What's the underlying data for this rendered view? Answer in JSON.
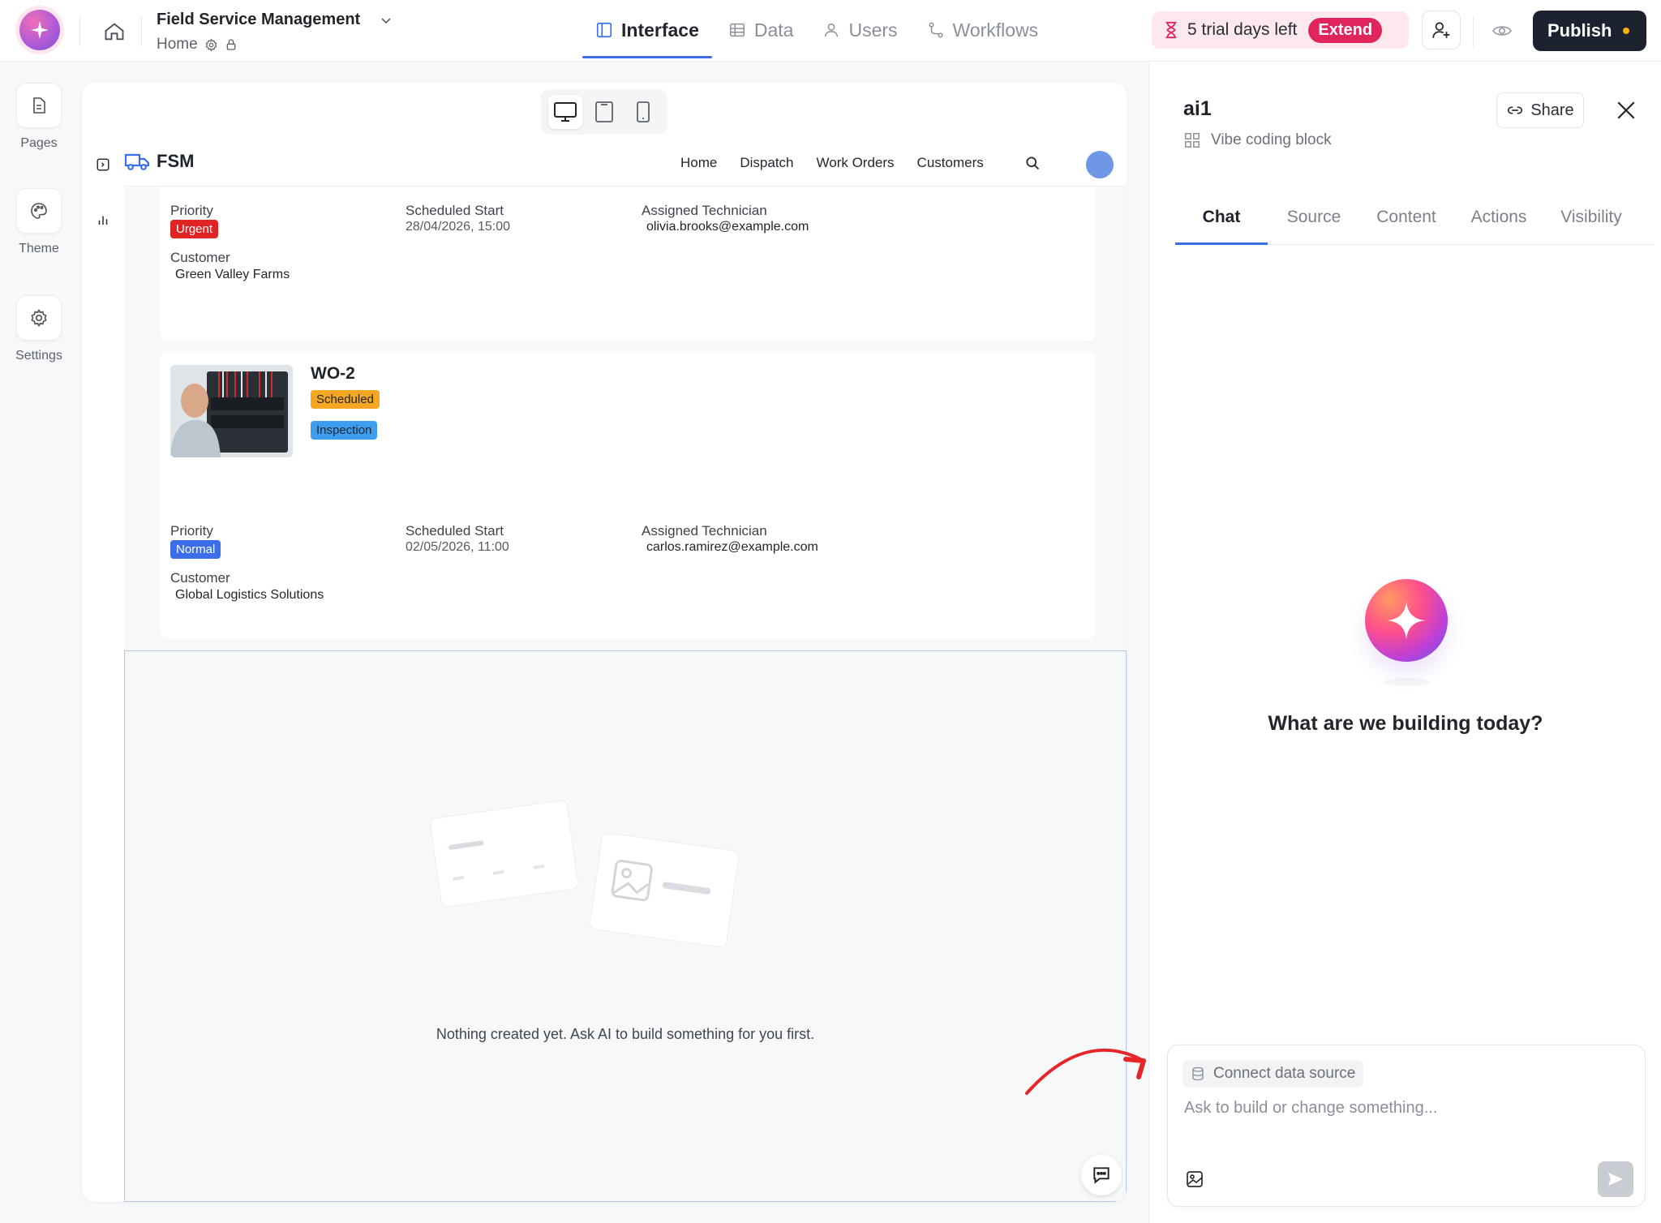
{
  "topbar": {
    "app_title": "Field Service Management",
    "app_subtitle": "Home",
    "tabs": [
      {
        "label": "Interface",
        "active": true
      },
      {
        "label": "Data",
        "active": false
      },
      {
        "label": "Users",
        "active": false
      },
      {
        "label": "Workflows",
        "active": false
      }
    ],
    "trial_text": "5 trial days left",
    "extend_label": "Extend",
    "publish_label": "Publish",
    "accent_color": "#3b6ee8"
  },
  "rail": {
    "items": [
      {
        "label": "Pages",
        "icon": "file-icon"
      },
      {
        "label": "Theme",
        "icon": "palette-icon"
      },
      {
        "label": "Settings",
        "icon": "gear-icon"
      }
    ]
  },
  "app": {
    "brand": "FSM",
    "menu": [
      "Home",
      "Dispatch",
      "Work Orders",
      "Customers"
    ],
    "labels": {
      "priority": "Priority",
      "scheduled_start": "Scheduled Start",
      "assigned_technician": "Assigned Technician",
      "customer": "Customer"
    },
    "work_orders": [
      {
        "id": "",
        "priority": "Urgent",
        "priority_color": "#e02424",
        "scheduled_start": "28/04/2026, 15:00",
        "technician": "olivia.brooks@example.com",
        "customer": "Green Valley Farms"
      },
      {
        "id": "WO-2",
        "status": "Scheduled",
        "status_color": "#f5a623",
        "type": "Inspection",
        "type_color": "#3d9ef0",
        "priority": "Normal",
        "priority_color": "#3b6ee8",
        "scheduled_start": "02/05/2026, 11:00",
        "technician": "carlos.ramirez@example.com",
        "customer": "Global Logistics Solutions"
      }
    ],
    "empty_message": "Nothing created yet. Ask AI to build something for you first."
  },
  "panel": {
    "title": "ai1",
    "subtitle": "Vibe coding block",
    "share_label": "Share",
    "tabs": [
      {
        "label": "Chat",
        "active": true
      },
      {
        "label": "Source",
        "active": false
      },
      {
        "label": "Content",
        "active": false
      },
      {
        "label": "Actions",
        "active": false
      },
      {
        "label": "Visibility",
        "active": false
      }
    ],
    "heading": "What are we building today?",
    "connect_label": "Connect data source",
    "input_placeholder": "Ask to build or change something..."
  }
}
